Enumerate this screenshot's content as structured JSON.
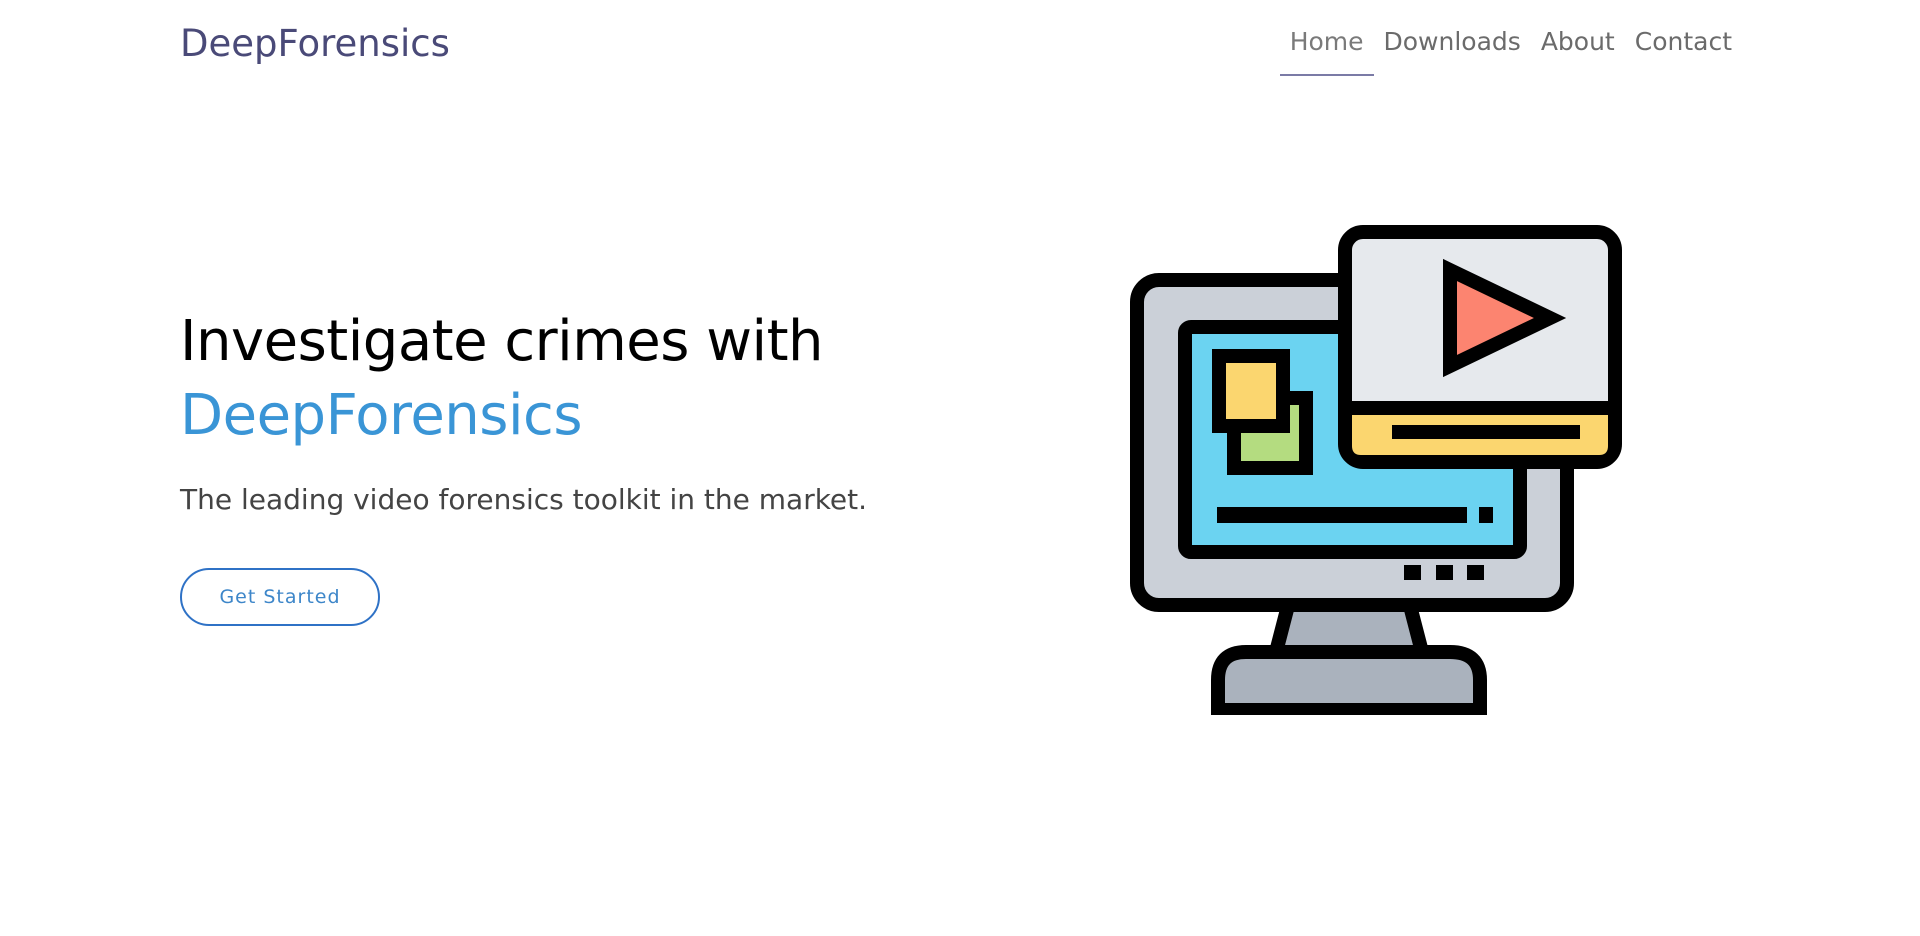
{
  "header": {
    "brand": "DeepForensics",
    "nav": [
      {
        "label": "Home",
        "active": true
      },
      {
        "label": "Downloads",
        "active": false
      },
      {
        "label": "About",
        "active": false
      },
      {
        "label": "Contact",
        "active": false
      }
    ]
  },
  "hero": {
    "headline_line1": "Investigate crimes with",
    "headline_accent": "DeepForensics",
    "subtitle": "The leading video forensics toolkit in the market.",
    "cta_label": "Get Started",
    "illustration_icon": "computer-video-player-icon"
  },
  "colors": {
    "brand": "#4a4a78",
    "accent": "#3a95d6",
    "button_border": "#2f72c6",
    "monitor_body": "#cbd0d8",
    "screen": "#6bd3f1",
    "player_bg": "#e6e9ed",
    "play_triangle": "#fc8470",
    "yellow": "#fbd66f",
    "green": "#b4dc80",
    "stand": "#aab2bd"
  }
}
